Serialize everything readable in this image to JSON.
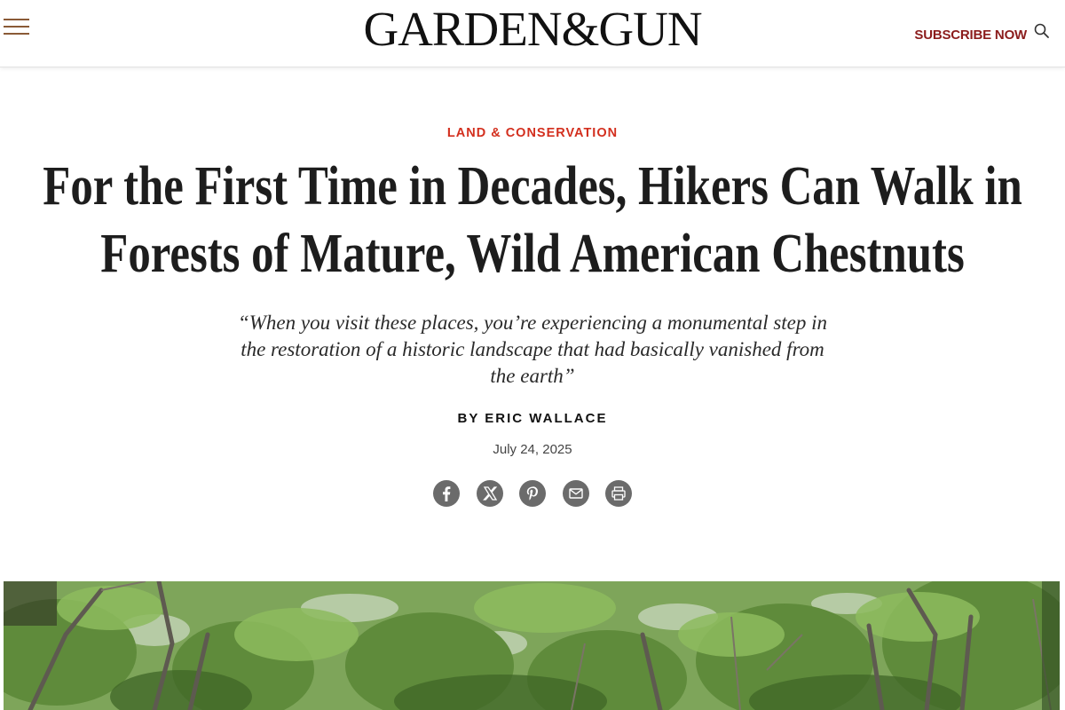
{
  "header": {
    "logo": "GARDEN&GUN",
    "subscribe_label": "SUBSCRIBE NOW",
    "menu_icon": "hamburger-icon",
    "search_icon": "search-icon",
    "colors": {
      "menu": "#8a5a36",
      "subscribe": "#8b1c1c"
    }
  },
  "article": {
    "category": "LAND & CONSERVATION",
    "category_color": "#d32f1e",
    "headline": "For the First Time in Decades, Hikers Can Walk in Forests of Mature, Wild American Chestnuts",
    "dek": "“When you visit these places, you’re experiencing a monumental step in the restoration of a historic landscape that had basically vanished from the earth”",
    "byline": "BY ERIC WALLACE",
    "date": "July 24, 2025"
  },
  "share": {
    "items": [
      {
        "icon": "facebook-icon"
      },
      {
        "icon": "x-icon"
      },
      {
        "icon": "pinterest-icon"
      },
      {
        "icon": "email-icon"
      },
      {
        "icon": "print-icon"
      }
    ]
  },
  "hero_image": {
    "subject": "forest-canopy"
  }
}
